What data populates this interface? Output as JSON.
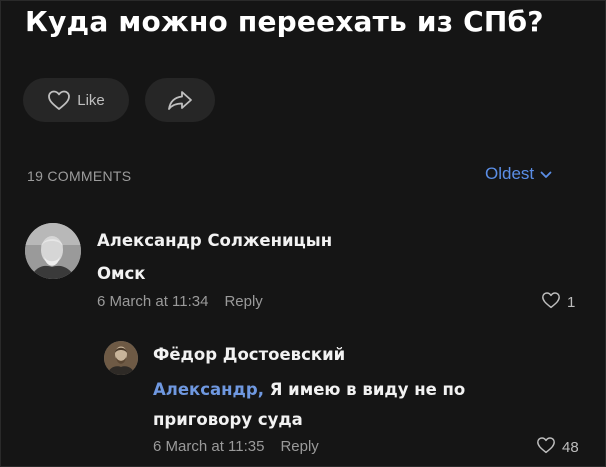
{
  "post": {
    "title": "Куда можно переехать из СПб?",
    "like_label": "Like"
  },
  "comments_header": {
    "count_label": "19 COMMENTS",
    "sort_label": "Oldest"
  },
  "colors": {
    "background": "#151515",
    "accent_link": "#5b8ee6",
    "mention": "#6f98e0",
    "muted_text": "#9a9a9a"
  },
  "comments": [
    {
      "author": "Александр Солженицын",
      "text": "Омск",
      "timestamp": "6 March at 11:34",
      "reply_label": "Reply",
      "likes": "1",
      "avatar_icon": "avatar-photo"
    },
    {
      "author": "Фёдор Достоевский",
      "mention": "Александр,",
      "text_line1": " Я имею в виду не по",
      "text_line2": "приговору суда",
      "timestamp": "6 March at 11:35",
      "reply_label": "Reply",
      "likes": "48",
      "avatar_icon": "avatar-photo"
    }
  ]
}
